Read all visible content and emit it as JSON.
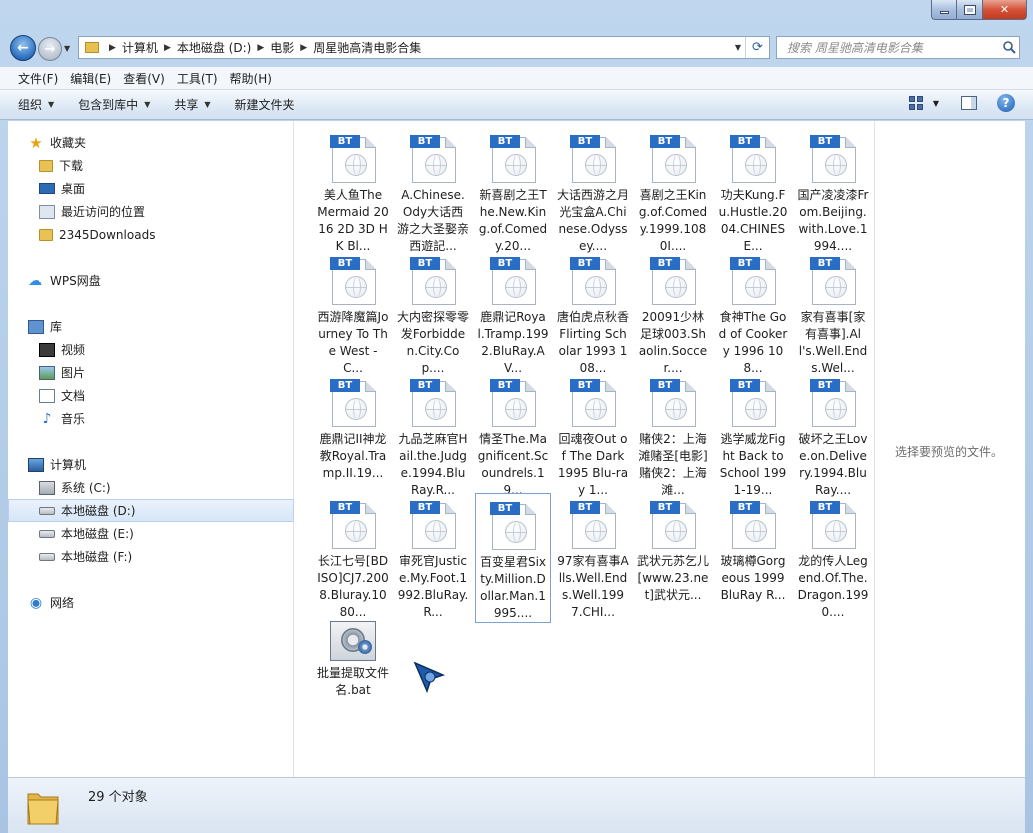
{
  "breadcrumb": [
    "计算机",
    "本地磁盘 (D:)",
    "电影",
    "周星驰高清电影合集"
  ],
  "search": {
    "placeholder": "搜索 周星驰高清电影合集"
  },
  "menu": [
    "文件(F)",
    "编辑(E)",
    "查看(V)",
    "工具(T)",
    "帮助(H)"
  ],
  "toolbar": {
    "organize": "组织",
    "include_library": "包含到库中",
    "share": "共享",
    "new_folder": "新建文件夹"
  },
  "nav": {
    "favorites": {
      "label": "收藏夹",
      "items": [
        "下载",
        "桌面",
        "最近访问的位置",
        "2345Downloads"
      ]
    },
    "wps": {
      "label": "WPS网盘"
    },
    "libraries": {
      "label": "库",
      "items": [
        "视频",
        "图片",
        "文档",
        "音乐"
      ]
    },
    "computer": {
      "label": "计算机",
      "items": [
        "系统 (C:)",
        "本地磁盘 (D:)",
        "本地磁盘 (E:)",
        "本地磁盘 (F:)"
      ]
    },
    "network": {
      "label": "网络"
    }
  },
  "files": [
    {
      "label": "美人鱼The Mermaid 2016 2D 3D HK Bl..."
    },
    {
      "label": "A.Chinese.Ody大话西游之大圣娶亲 西遊記..."
    },
    {
      "label": "新喜剧之王The.New.King.of.Comedy.20..."
    },
    {
      "label": "大话西游之月光宝盒A.Chinese.Odyssey...."
    },
    {
      "label": "喜剧之王King.of.Comedy.1999.1080I...."
    },
    {
      "label": "功夫Kung.Fu.Hustle.2004.CHINESE..."
    },
    {
      "label": "国产凌凌漆From.Beijing.with.Love.1994...."
    },
    {
      "label": "西游降魔篇Journey To The West - C..."
    },
    {
      "label": "大内密探零零发Forbidden.City.Cop...."
    },
    {
      "label": "鹿鼎记Royal.Tramp.1992.BluRay.AV..."
    },
    {
      "label": "唐伯虎点秋香Flirting Scholar 1993 108..."
    },
    {
      "label": "20091少林足球003.Shaolin.Soccer...."
    },
    {
      "label": "食神The God of Cookery 1996 108..."
    },
    {
      "label": "家有喜事[家有喜事].All's.Well.Ends.Wel..."
    },
    {
      "label": "鹿鼎记II神龙教Royal.Tramp.II.19..."
    },
    {
      "label": "九品芝麻官Hail.the.Judge.1994.BluRay.R..."
    },
    {
      "label": "情圣The.Magnificent.Scoundrels.19..."
    },
    {
      "label": "回魂夜Out of The Dark 1995 Blu-ray 1..."
    },
    {
      "label": "赌侠2：上海滩赌圣[电影]赌侠2：上海滩..."
    },
    {
      "label": "逃学威龙Fight Back to School 1991-19..."
    },
    {
      "label": "破坏之王Love.on.Delivery.1994.BluRay...."
    },
    {
      "label": "长江七号[BDISO]CJ7.2008.Bluray.1080..."
    },
    {
      "label": "审死官Justice.My.Foot.1992.BluRay.R..."
    },
    {
      "label": "百变星君Sixty.Million.Dollar.Man.1995...."
    },
    {
      "label": "97家有喜事Alls.Well.Ends.Well.1997.CHI..."
    },
    {
      "label": "武状元苏乞儿[www.23.net]武状元..."
    },
    {
      "label": "玻璃樽Gorgeous 1999 BluRay R..."
    },
    {
      "label": "龙的传人Legend.Of.The.Dragon.1990...."
    },
    {
      "label": "批量提取文件名.bat"
    }
  ],
  "file_badge": "BT",
  "preview_text": "选择要预览的文件。",
  "status": {
    "count": "29 个对象"
  }
}
